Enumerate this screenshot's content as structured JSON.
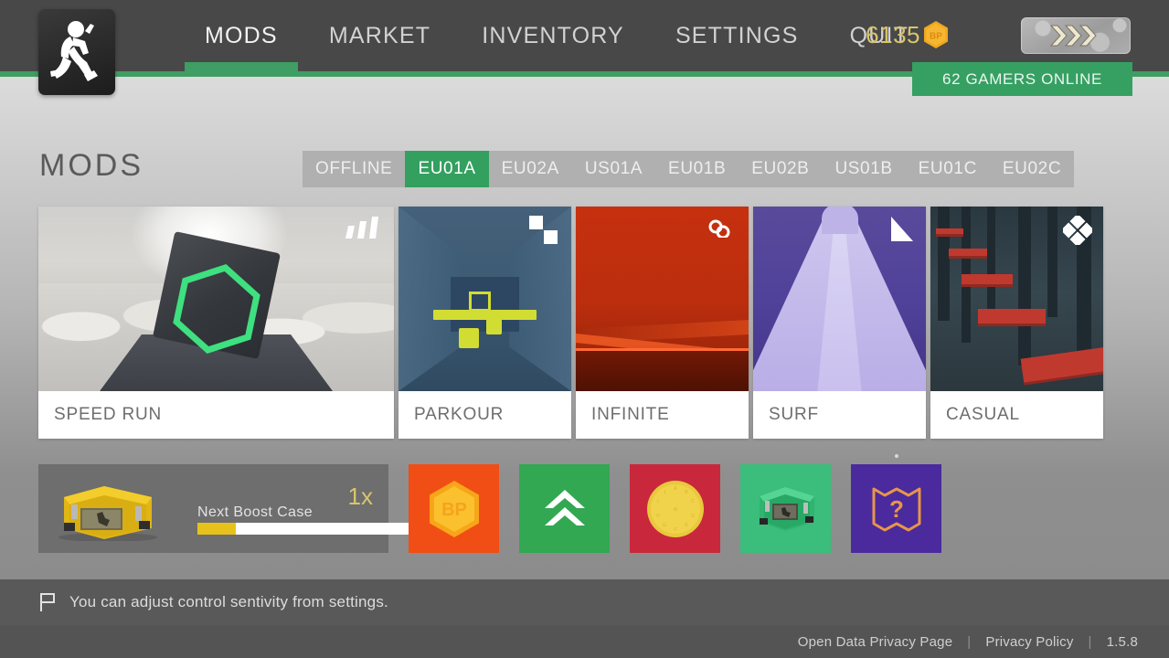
{
  "header": {
    "logo_icon": "running-soldier-icon",
    "nav": [
      {
        "label": "MODS",
        "active": true
      },
      {
        "label": "MARKET",
        "active": false
      },
      {
        "label": "INVENTORY",
        "active": false
      },
      {
        "label": "SETTINGS",
        "active": false
      },
      {
        "label": "QUIT",
        "active": false
      }
    ],
    "currency": {
      "amount": "6135",
      "icon": "bp-hexagon-icon",
      "icon_text": "BP"
    },
    "rank_badge_icon": "triple-chevron-rank-icon",
    "online_banner": "62 GAMERS ONLINE"
  },
  "page": {
    "title": "MODS"
  },
  "servers": [
    {
      "label": "OFFLINE",
      "active": false
    },
    {
      "label": "EU01A",
      "active": true
    },
    {
      "label": "EU02A",
      "active": false
    },
    {
      "label": "US01A",
      "active": false
    },
    {
      "label": "EU01B",
      "active": false
    },
    {
      "label": "EU02B",
      "active": false
    },
    {
      "label": "US01B",
      "active": false
    },
    {
      "label": "EU01C",
      "active": false
    },
    {
      "label": "EU02C",
      "active": false
    }
  ],
  "modes": [
    {
      "label": "SPEED RUN",
      "badge_icon": "speed-bars-icon",
      "accent": "#3ee07f"
    },
    {
      "label": "PARKOUR",
      "badge_icon": "two-squares-icon",
      "accent": "#d2dd33"
    },
    {
      "label": "INFINITE",
      "badge_icon": "infinity-icon",
      "accent": "#c6300f"
    },
    {
      "label": "SURF",
      "badge_icon": "triangle-icon",
      "accent": "#594a9b"
    },
    {
      "label": "CASUAL",
      "badge_icon": "four-diamonds-icon",
      "accent": "#c0392f"
    }
  ],
  "boost": {
    "title": "Next Boost Case",
    "multiplier": "1x",
    "progress_percent": 18,
    "case_icon": "yellow-case-icon"
  },
  "actions": [
    {
      "name": "buy-bp-button",
      "icon": "bp-hexagon-icon",
      "label": "BP",
      "color": "#f04e14"
    },
    {
      "name": "upgrade-button",
      "icon": "double-chevron-up-icon",
      "color": "#32a852"
    },
    {
      "name": "daily-spin-button",
      "icon": "gold-coin-icon",
      "color": "#c9283c"
    },
    {
      "name": "open-case-button",
      "icon": "green-case-icon",
      "color": "#3bbd7c"
    },
    {
      "name": "mystery-map-button",
      "icon": "map-question-icon",
      "color": "#4a2a9c",
      "has_dot": true
    }
  ],
  "tip": {
    "icon": "flag-icon",
    "text": "You can adjust control sentivity from settings."
  },
  "footer": {
    "data_privacy": "Open Data Privacy Page",
    "privacy_policy": "Privacy Policy",
    "separator": "|",
    "version": "1.5.8"
  },
  "colors": {
    "green": "#36a063",
    "dark_bar": "#484848",
    "gold": "#d8c56b"
  }
}
